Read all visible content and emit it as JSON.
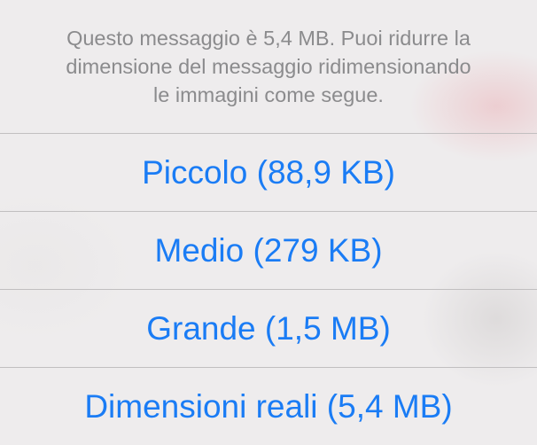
{
  "action_sheet": {
    "message": "Questo messaggio è 5,4 MB. Puoi ridurre la dimensione del messaggio ridimensionando le immagini come segue.",
    "message_lines": [
      "Questo messaggio è 5,4 MB. Puoi ridurre la",
      "dimensione del messaggio ridimensionando",
      "le immagini come segue."
    ],
    "options": [
      {
        "label": "Piccolo (88,9 KB)"
      },
      {
        "label": "Medio (279 KB)"
      },
      {
        "label": "Grande (1,5 MB)"
      },
      {
        "label": "Dimensioni reali (5,4 MB)"
      }
    ],
    "colors": {
      "accent": "#1a7cf5",
      "message_text": "#8b8b8d",
      "separator": "#c1bfc0",
      "background": "#eeeced"
    }
  }
}
